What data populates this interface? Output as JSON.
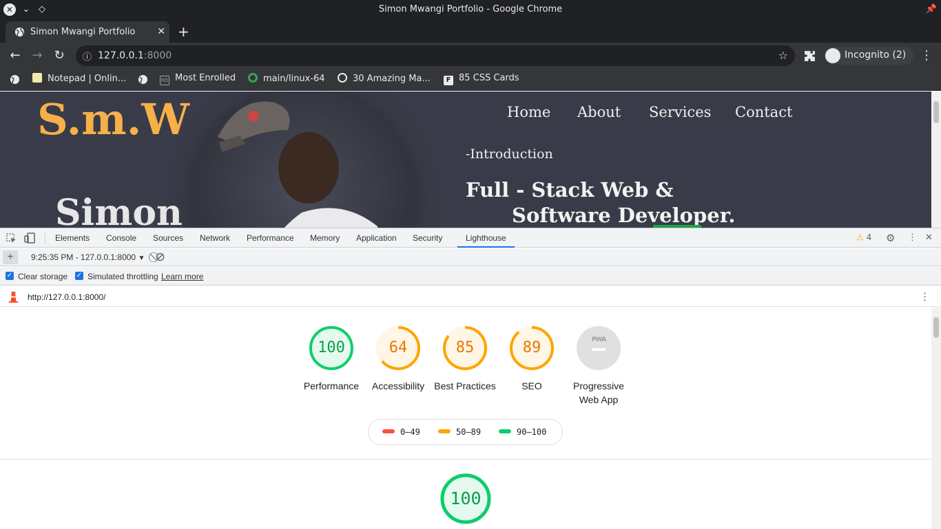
{
  "window": {
    "title": "Simon Mwangi Portfolio - Google Chrome"
  },
  "tab": {
    "title": "Simon Mwangi Portfolio"
  },
  "toolbar": {
    "url_host": "127.0.0.1",
    "url_port": ":8000",
    "profile": "Incognito (2)"
  },
  "bookmarks": [
    {
      "label": "Notepad | Onlin...",
      "icon": "notepad-icon"
    },
    {
      "label": "Most Enrolled",
      "icon": "rd-icon"
    },
    {
      "label": "main/linux-64",
      "icon": "ring-icon"
    },
    {
      "label": "30 Amazing Ma...",
      "icon": "badge-icon"
    },
    {
      "label": "85 CSS Cards",
      "icon": "f-icon"
    }
  ],
  "site": {
    "logo": "S.m.W",
    "name": "Simon",
    "nav": [
      "Home",
      "About",
      "Services",
      "Contact"
    ],
    "intro": "-Introduction",
    "headline_line1": "Full - Stack Web &",
    "headline_line2": "Software Developer."
  },
  "devtools": {
    "tabs": [
      "Elements",
      "Console",
      "Sources",
      "Network",
      "Performance",
      "Memory",
      "Application",
      "Security",
      "Lighthouse"
    ],
    "warning_count": "4",
    "report_selector": "9:25:35 PM - 127.0.0.1:8000",
    "clear_storage": "Clear storage",
    "simulated_throttling": "Simulated throttling",
    "learn_more": "Learn more",
    "report_url": "http://127.0.0.1:8000/"
  },
  "lighthouse": {
    "scores": [
      {
        "label": "Performance",
        "value": "100",
        "fraction": 1.0,
        "color": "#0cce6b"
      },
      {
        "label": "Accessibility",
        "value": "64",
        "fraction": 0.64,
        "color": "#ffa400"
      },
      {
        "label": "Best Practices",
        "value": "85",
        "fraction": 0.85,
        "color": "#ffa400"
      },
      {
        "label": "SEO",
        "value": "89",
        "fraction": 0.89,
        "color": "#ffa400"
      }
    ],
    "pwa_label": "Progressive Web App",
    "pwa_badge": "PWA",
    "legend": [
      {
        "label": "0–49",
        "color": "#ff4e42"
      },
      {
        "label": "50–89",
        "color": "#ffa400"
      },
      {
        "label": "90–100",
        "color": "#0cce6b"
      }
    ],
    "performance_big": "100"
  }
}
